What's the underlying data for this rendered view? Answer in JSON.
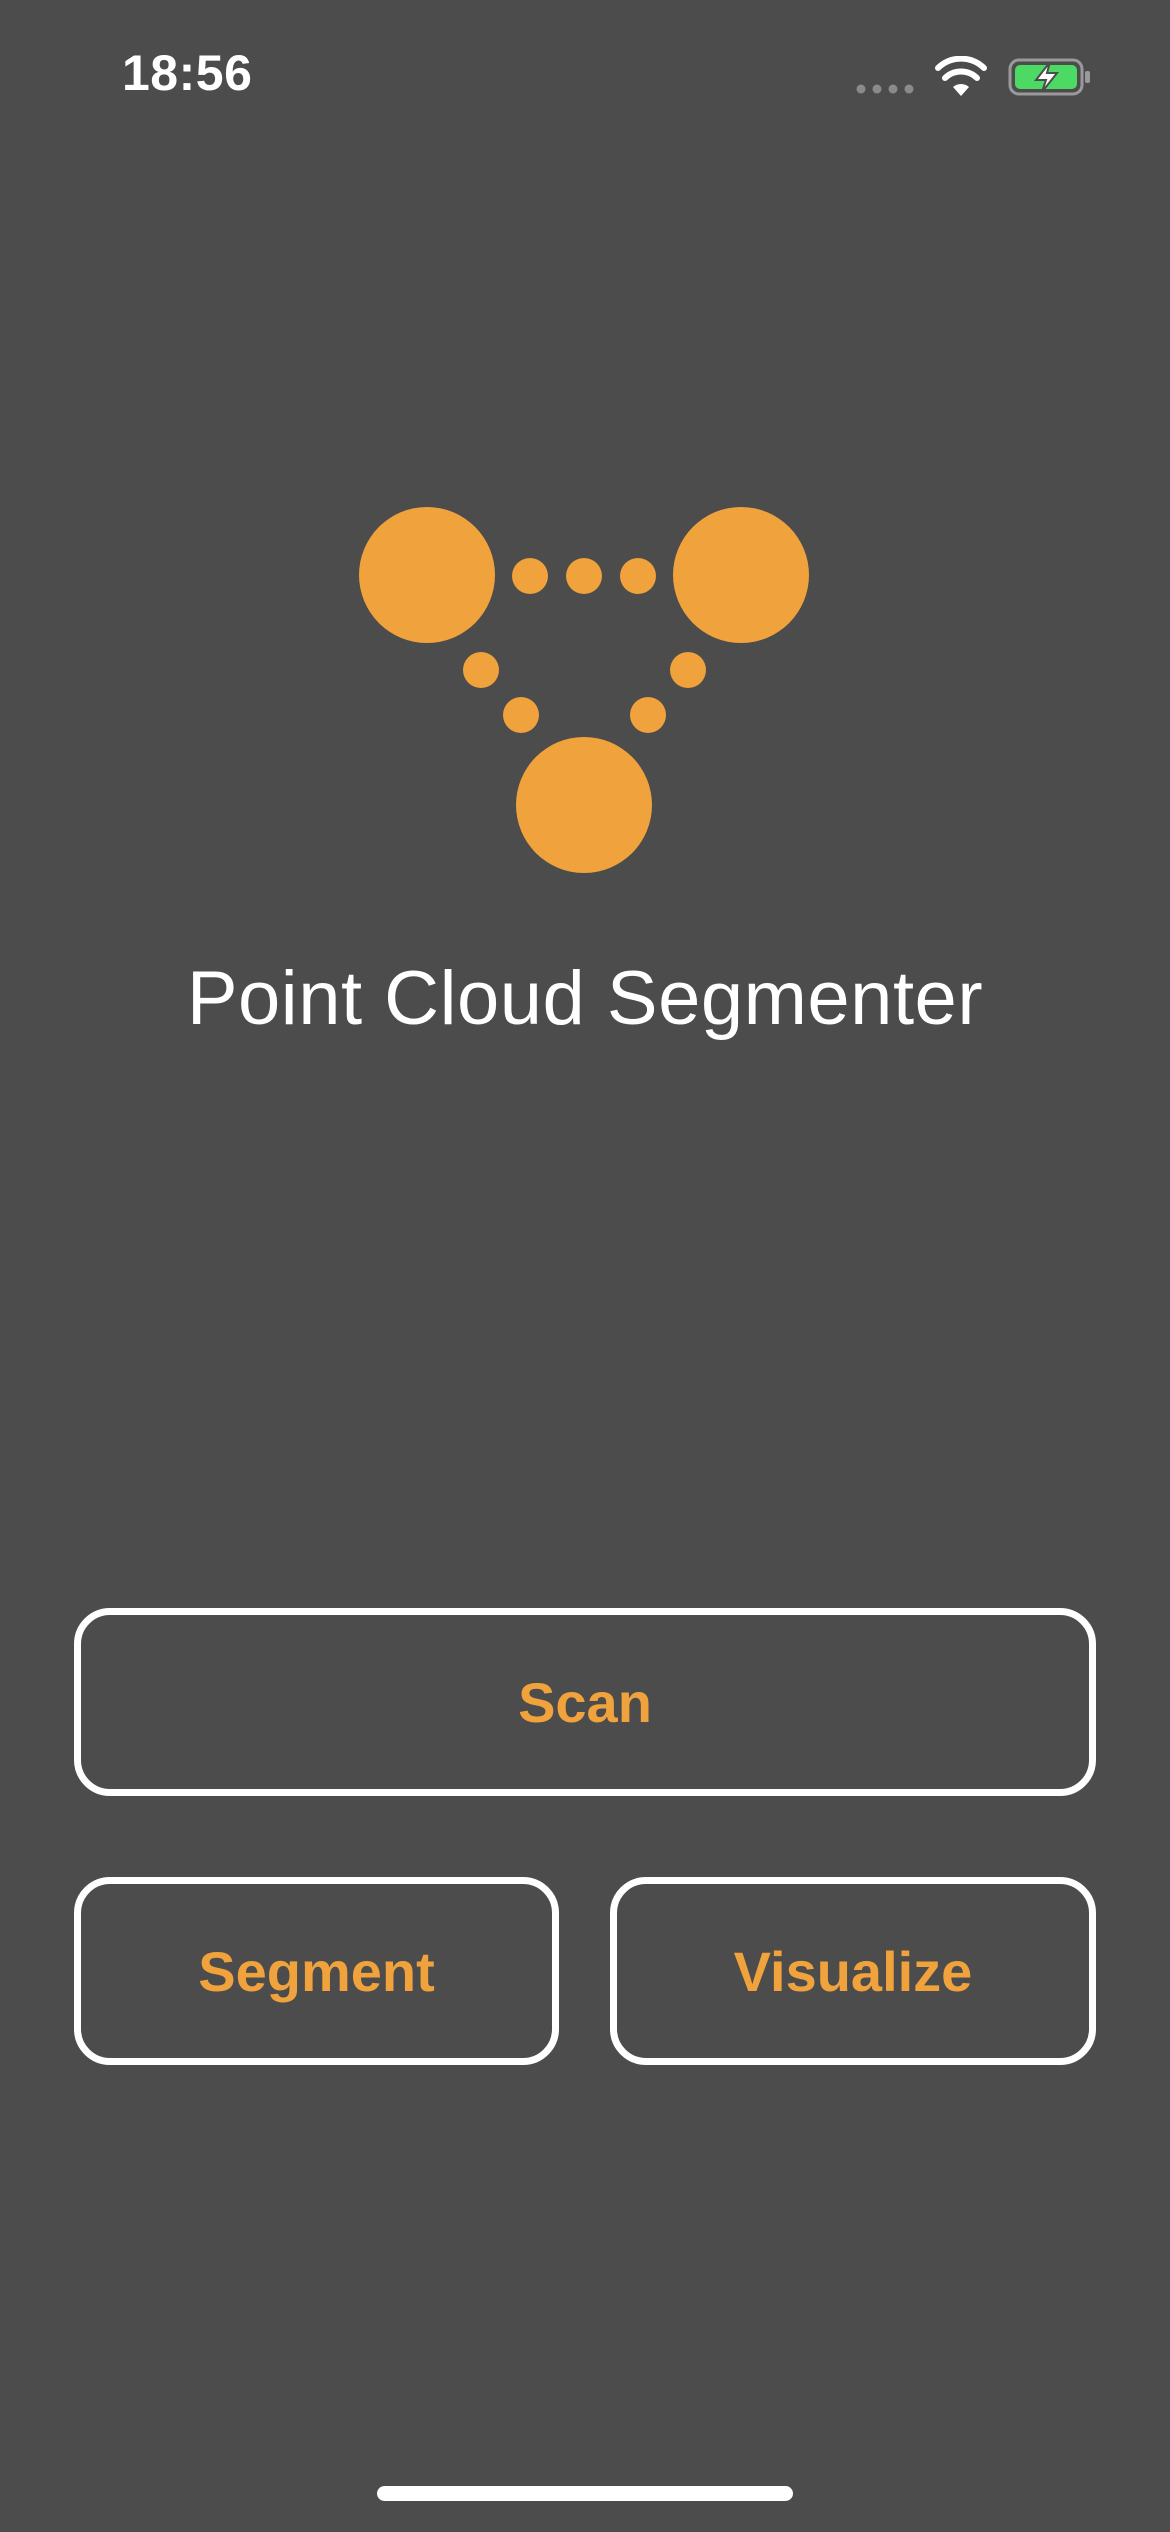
{
  "status_bar": {
    "time": "18:56",
    "signal_icon": "cellular-signal-icon",
    "wifi_icon": "wifi-icon",
    "battery_icon": "battery-charging-icon",
    "battery_color": "#4cd964"
  },
  "app": {
    "title": "Point Cloud Segmenter",
    "logo_icon": "point-cloud-logo-icon",
    "accent_color": "#f0a23c",
    "background_color": "#4c4c4c"
  },
  "actions": {
    "scan_label": "Scan",
    "segment_label": "Segment",
    "visualize_label": "Visualize"
  }
}
